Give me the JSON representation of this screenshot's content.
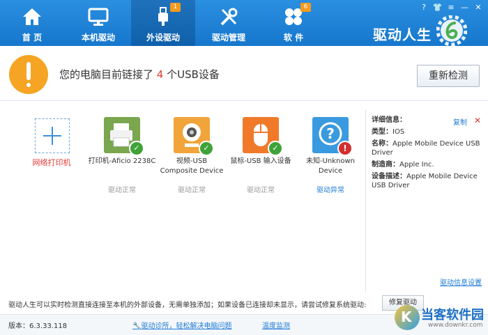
{
  "window": {
    "help": "?",
    "shirt": "👕",
    "menu": "≡",
    "minimize": "—",
    "close": "✕"
  },
  "brand": "驱动人生",
  "nav": [
    {
      "label": "首 页",
      "icon": "home-icon",
      "badge": ""
    },
    {
      "label": "本机驱动",
      "icon": "monitor-icon",
      "badge": ""
    },
    {
      "label": "外设驱动",
      "icon": "usb-icon",
      "badge": "1"
    },
    {
      "label": "驱动管理",
      "icon": "tools-icon",
      "badge": ""
    },
    {
      "label": "软 件",
      "icon": "apps-icon",
      "badge": "6"
    }
  ],
  "summary": {
    "prefix": "您的电脑目前链接了 ",
    "count": "4",
    "suffix": " 个USB设备"
  },
  "redetect_label": "重新检测",
  "add_label": "网络打印机",
  "devices": [
    {
      "name": "打印机-Aficio 2238C",
      "status": "驱动正常",
      "icon": "printer-icon",
      "color": "#7aa64e",
      "ok": true
    },
    {
      "name": "视频-USB Composite Device",
      "status": "驱动正常",
      "icon": "webcam-icon",
      "color": "#f0a43a",
      "ok": true
    },
    {
      "name": "鼠标-USB 输入设备",
      "status": "驱动正常",
      "icon": "mouse-icon",
      "color": "#f07a2a",
      "ok": true
    },
    {
      "name": "未知-Unknown Device",
      "status": "驱动异常",
      "icon": "question-icon",
      "color": "#3a9ae0",
      "ok": false
    }
  ],
  "details": {
    "title": "详细信息：",
    "copy": "复制",
    "close": "✕",
    "type_label": "类型：",
    "type_value": "IOS",
    "name_label": "名称：",
    "name_value": "Apple Mobile Device USB Driver",
    "maker_label": "制造商：",
    "maker_value": "Apple Inc.",
    "desc_label": "设备描述：",
    "desc_value": "Apple Mobile Device USB Driver"
  },
  "driver_settings": "驱动信息设置",
  "hint": "驱动人生可以实时检测直接连接至本机的外部设备，无需单独添加；如果设备已连接却未显示，请尝试修复系统驱动:",
  "repair_label": "修复驱动",
  "footer": {
    "version": "版本：6.3.33.118",
    "diagnose": "驱动诊所，轻松解决电脑问题",
    "temp": "温度监测"
  },
  "watermark": {
    "title": "当客软件园",
    "url": "www.downkr.com",
    "logo": "K"
  }
}
